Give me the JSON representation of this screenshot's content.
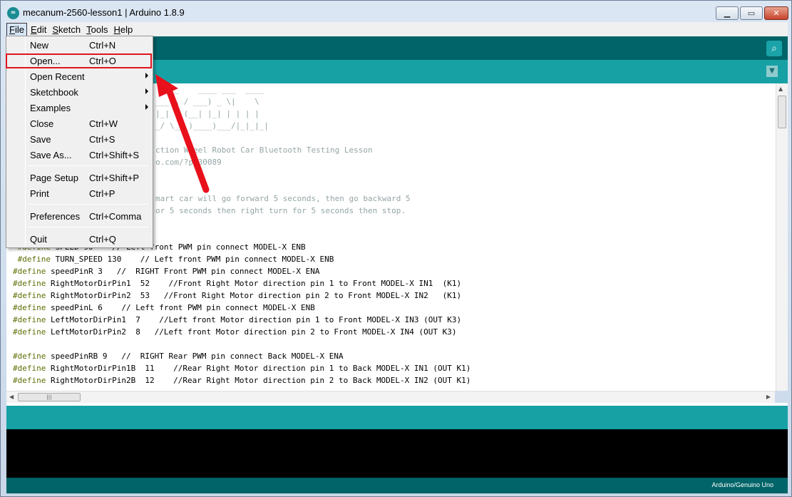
{
  "window": {
    "title": "mecanum-2560-lesson1 | Arduino 1.8.9",
    "controls": [
      "minimize",
      "maximize",
      "close"
    ]
  },
  "menubar": {
    "items": [
      {
        "label": "File",
        "hotkey": "F",
        "rest": "ile"
      },
      {
        "label": "Edit",
        "hotkey": "E",
        "rest": "dit"
      },
      {
        "label": "Sketch",
        "hotkey": "S",
        "rest": "ketch"
      },
      {
        "label": "Tools",
        "hotkey": "T",
        "rest": "ools"
      },
      {
        "label": "Help",
        "hotkey": "H",
        "rest": "elp"
      }
    ]
  },
  "file_menu": {
    "items": [
      {
        "label": "New",
        "shortcut": "Ctrl+N"
      },
      {
        "label": "Open...",
        "shortcut": "Ctrl+O"
      },
      {
        "label": "Open Recent",
        "shortcut": ""
      },
      {
        "label": "Sketchbook",
        "shortcut": ""
      },
      {
        "label": "Examples",
        "shortcut": ""
      },
      {
        "label": "Close",
        "shortcut": "Ctrl+W"
      },
      {
        "label": "Save",
        "shortcut": "Ctrl+S"
      },
      {
        "label": "Save As...",
        "shortcut": "Ctrl+Shift+S"
      },
      {
        "label": "Page Setup",
        "shortcut": "Ctrl+Shift+P"
      },
      {
        "label": "Print",
        "shortcut": "Ctrl+P"
      },
      {
        "label": "Preferences",
        "shortcut": "Ctrl+Comma"
      },
      {
        "label": "Quit",
        "shortcut": "Ctrl+Q"
      }
    ]
  },
  "editor": {
    "lines": [
      {
        "kw": "",
        "rest": "  ___    ____ ___  ____",
        "cm": true
      },
      {
        "kw": "",
        "rest": "___ \\ / ___) _ \\|    \\",
        "cm": true
      },
      {
        "kw": "",
        "rest": "|_| ( (__| |_| | | | |",
        "cm": true
      },
      {
        "kw": "",
        "rest": "_/ \\___)____)___/|_|_|_|",
        "cm": true
      },
      {
        "kw": "",
        "rest": "",
        "cm": true
      },
      {
        "kw": "",
        "rest": "ction Wheel Robot Car Bluetooth Testing Lesson",
        "cm": true
      },
      {
        "kw": "",
        "rest": "o.com/?p=30089",
        "cm": true
      },
      {
        "kw": "",
        "rest": "",
        "cm": true
      },
      {
        "kw": "",
        "rest": "",
        "cm": true
      },
      {
        "kw": "",
        "rest": "mart car will go forward 5 seconds, then go backward 5",
        "cm": true
      },
      {
        "kw": "",
        "rest": "or 5 seconds then right turn for 5 seconds then stop.",
        "cm": true
      },
      {
        "kw": "",
        "rest": "",
        "cm": true
      },
      {
        "kw": "",
        "rest": "",
        "cm": true
      },
      {
        "kw": " #define",
        "rest": " SPEED 90    // Left front PWM pin connect MODEL-X ENB",
        "cm": false
      },
      {
        "kw": " #define",
        "rest": " TURN_SPEED 130    // Left front PWM pin connect MODEL-X ENB",
        "cm": false
      },
      {
        "kw": "#define",
        "rest": " speedPinR 3   //  RIGHT Front PWM pin connect MODEL-X ENA",
        "cm": false
      },
      {
        "kw": "#define",
        "rest": " RightMotorDirPin1  52    //Front Right Motor direction pin 1 to Front MODEL-X IN1  (K1)",
        "cm": false
      },
      {
        "kw": "#define",
        "rest": " RightMotorDirPin2  53   //Front Right Motor direction pin 2 to Front MODEL-X IN2   (K1)",
        "cm": false
      },
      {
        "kw": "#define",
        "rest": " speedPinL 6    // Left front PWM pin connect MODEL-X ENB",
        "cm": false
      },
      {
        "kw": "#define",
        "rest": " LeftMotorDirPin1  7    //Left front Motor direction pin 1 to Front MODEL-X IN3 (OUT K3)",
        "cm": false
      },
      {
        "kw": "#define",
        "rest": " LeftMotorDirPin2  8   //Left front Motor direction pin 2 to Front MODEL-X IN4 (OUT K3)",
        "cm": false
      },
      {
        "kw": "",
        "rest": "",
        "cm": false
      },
      {
        "kw": "#define",
        "rest": " speedPinRB 9   //  RIGHT Rear PWM pin connect Back MODEL-X ENA",
        "cm": false
      },
      {
        "kw": "#define",
        "rest": " RightMotorDirPin1B  11    //Rear Right Motor direction pin 1 to Back MODEL-X IN1 (OUT K1)",
        "cm": false
      },
      {
        "kw": "#define",
        "rest": " RightMotorDirPin2B  12    //Rear Right Motor direction pin 2 to Back MODEL-X IN2 (OUT K1)",
        "cm": false
      }
    ]
  },
  "footer": {
    "board": "Arduino/Genuino Uno"
  },
  "colors": {
    "toolbar": "#006468",
    "tabbar": "#17a1a5",
    "highlight": "#e0141e",
    "keyword": "#5e6d03",
    "comment": "#95a5a6"
  }
}
